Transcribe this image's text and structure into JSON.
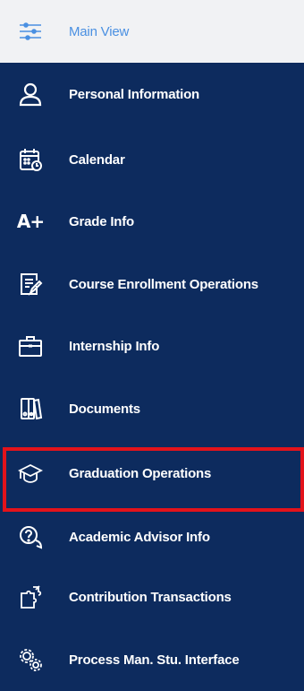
{
  "sidebar": {
    "items": [
      {
        "label": "Main View",
        "icon": "sliders-icon",
        "active": true
      },
      {
        "label": "Personal Information",
        "icon": "user-icon"
      },
      {
        "label": "Calendar",
        "icon": "calendar-icon"
      },
      {
        "label": "Grade Info",
        "icon": "grade-a-plus-icon"
      },
      {
        "label": "Course Enrollment Operations",
        "icon": "document-edit-icon"
      },
      {
        "label": "Internship Info",
        "icon": "briefcase-icon"
      },
      {
        "label": "Documents",
        "icon": "binders-icon"
      },
      {
        "label": "Graduation Operations",
        "icon": "graduation-cap-icon",
        "highlighted": true
      },
      {
        "label": "Academic Advisor Info",
        "icon": "question-chat-icon"
      },
      {
        "label": "Contribution Transactions",
        "icon": "puzzle-icon"
      },
      {
        "label": "Process Man. Stu. Interface",
        "icon": "gears-icon"
      }
    ],
    "grade_icon_text": "A+"
  },
  "colors": {
    "sidebar_bg": "#0d2b5e",
    "active_bg": "#f1f2f4",
    "active_text": "#4a90e2",
    "highlight": "#e3131b"
  }
}
